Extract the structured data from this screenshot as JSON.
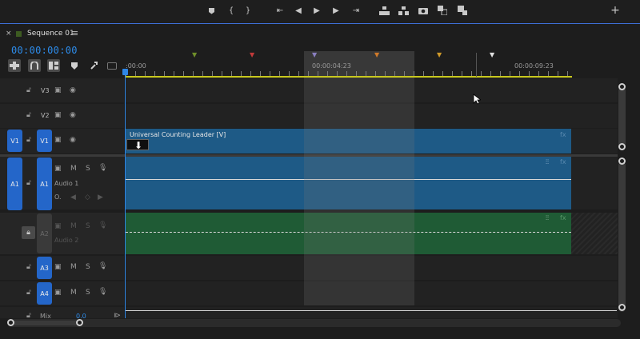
{
  "transport": {
    "buttons": [
      {
        "name": "add-marker-icon",
        "glyph": "⬟"
      },
      {
        "name": "mark-in-icon",
        "glyph": "{"
      },
      {
        "name": "mark-out-icon",
        "glyph": "}"
      },
      {
        "name": "go-to-in-icon",
        "glyph": "⇤"
      },
      {
        "name": "step-back-icon",
        "glyph": "◀"
      },
      {
        "name": "play-icon",
        "glyph": "▶"
      },
      {
        "name": "step-forward-icon",
        "glyph": "▶"
      },
      {
        "name": "go-to-out-icon",
        "glyph": "⇥"
      },
      {
        "name": "lift-icon",
        "glyph": "⬒"
      },
      {
        "name": "extract-icon",
        "glyph": "⬓"
      },
      {
        "name": "export-frame-icon",
        "glyph": "◉"
      },
      {
        "name": "compare-icon",
        "glyph": "⧉"
      },
      {
        "name": "add-icon",
        "glyph": "+"
      }
    ]
  },
  "sequence": {
    "close_glyph": "×",
    "title": "Sequence 01",
    "menu_glyph": "≡",
    "timecode": "00:00:00:00"
  },
  "ruler": {
    "labels": [
      ":00:00",
      "00:00:04:23",
      "00:00:09:23"
    ]
  },
  "tracks": {
    "video": [
      {
        "label": "V3",
        "source": ""
      },
      {
        "label": "V2",
        "source": ""
      },
      {
        "label": "V1",
        "source": "V1"
      }
    ],
    "audio": [
      {
        "label": "A1",
        "source": "A1",
        "name": "Audio 1",
        "m": "M",
        "s": "S"
      },
      {
        "label": "A2",
        "source": "",
        "name": "Audio 2",
        "m": "M",
        "s": "S"
      },
      {
        "label": "A3",
        "source": "",
        "name": "",
        "m": "M",
        "s": "S"
      },
      {
        "label": "A4",
        "source": "",
        "name": "",
        "m": "M",
        "s": "S"
      }
    ],
    "mix": {
      "label": "Mix",
      "value": "0.0"
    }
  },
  "clips": {
    "video_title": "Universal Counting Leader [V]",
    "fx": "fx"
  },
  "colors": {
    "accent": "#2e87e8",
    "video_clip": "#1e5a86",
    "audio_clip_green": "#1f5b35",
    "ruler_yellow": "#c8c81e"
  }
}
